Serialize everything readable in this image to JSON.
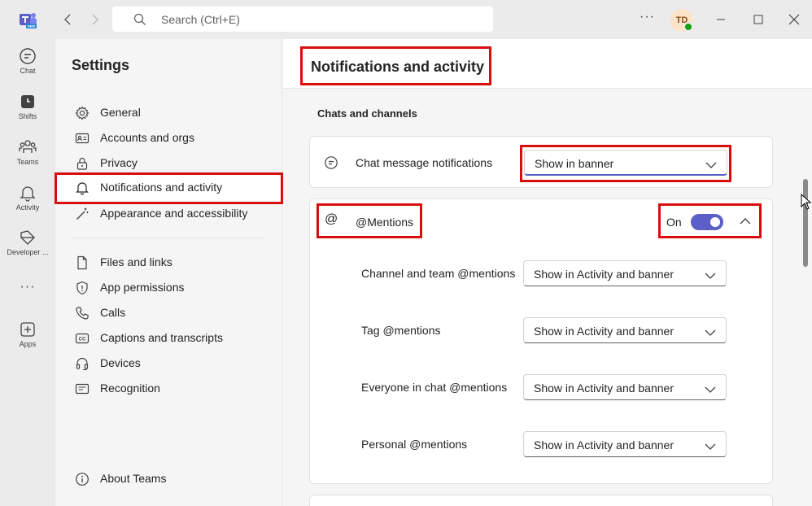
{
  "titlebar": {
    "search_placeholder": "Search (Ctrl+E)",
    "avatar_initials": "TD",
    "more": "···",
    "logo_badge": "NEW"
  },
  "rail": {
    "items": [
      {
        "label": "Chat",
        "icon": "chat-icon"
      },
      {
        "label": "Shifts",
        "icon": "shifts-icon"
      },
      {
        "label": "Teams",
        "icon": "teams-icon"
      },
      {
        "label": "Activity",
        "icon": "bell-icon"
      },
      {
        "label": "Developer ...",
        "icon": "developer-portal-icon"
      },
      {
        "label": "···",
        "icon": "more-apps-icon"
      },
      {
        "label": "Apps",
        "icon": "add-apps-icon"
      }
    ]
  },
  "settings_nav": {
    "title": "Settings",
    "items": [
      {
        "label": "General",
        "icon": "gear-icon"
      },
      {
        "label": "Accounts and orgs",
        "icon": "accounts-icon"
      },
      {
        "label": "Privacy",
        "icon": "lock-icon"
      },
      {
        "label": "Notifications and activity",
        "icon": "bell-icon",
        "active": true
      },
      {
        "label": "Appearance and accessibility",
        "icon": "wand-icon"
      },
      {
        "label": "Files and links",
        "icon": "file-icon"
      },
      {
        "label": "App permissions",
        "icon": "shield-icon"
      },
      {
        "label": "Calls",
        "icon": "phone-icon"
      },
      {
        "label": "Captions and transcripts",
        "icon": "cc-icon"
      },
      {
        "label": "Devices",
        "icon": "headset-icon"
      },
      {
        "label": "Recognition",
        "icon": "recognition-icon"
      }
    ],
    "about": {
      "label": "About Teams",
      "icon": "info-icon"
    }
  },
  "main": {
    "title": "Notifications and activity",
    "section_title": "Chats and channels",
    "chat_message": {
      "label": "Chat message notifications",
      "value": "Show in banner"
    },
    "mentions": {
      "label": "@Mentions",
      "icon_glyph": "@",
      "toggle_label": "On",
      "toggle_on": true,
      "rows": [
        {
          "label": "Channel and team @mentions",
          "value": "Show in Activity and banner"
        },
        {
          "label": "Tag @mentions",
          "value": "Show in Activity and banner"
        },
        {
          "label": "Everyone in chat @mentions",
          "value": "Show in Activity and banner"
        },
        {
          "label": "Personal @mentions",
          "value": "Show in Activity and banner"
        }
      ]
    }
  },
  "colors": {
    "highlight": "#d90d0d",
    "toggle_on": "#5b5fc7",
    "presence": "#13a10e"
  }
}
